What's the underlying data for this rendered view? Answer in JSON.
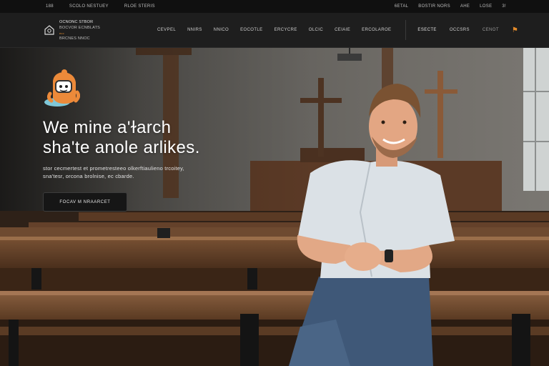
{
  "topbar": {
    "left_items": [
      "188",
      "scolo nestuey",
      "rloe steris"
    ],
    "right_items": [
      "6etal",
      "bostir nors",
      "ahe",
      "lose",
      "3!"
    ]
  },
  "brand": {
    "line1": "ocnonc stbor",
    "line2": "bocvor ecnblats",
    "line3": "ecc",
    "line4": "brcnes nnoc"
  },
  "nav": {
    "items": [
      "cevpel",
      "nnirs",
      "nnico",
      "eocotle",
      "ercycre",
      "olcic",
      "ceiaie",
      "ercolaroe"
    ],
    "cta": "esecte",
    "right": "occsrs",
    "lang": "cenot",
    "flag_glyph": "⚑"
  },
  "hero": {
    "headline_line1": "We mine a'ɫarch",
    "headline_line2": "sha'te anole arlikes.",
    "subtext_line1": "stor cecmertest et prometresteeo olkerftiaulieno trcoitey,",
    "subtext_line2": "sna'tesr, orcona brolnise, ec cbarde.",
    "button_label": "focav m nraarcet"
  },
  "colors": {
    "accent": "#e08a2c",
    "nav_bg": "#1e1e1e",
    "topbar_bg": "#101010"
  }
}
